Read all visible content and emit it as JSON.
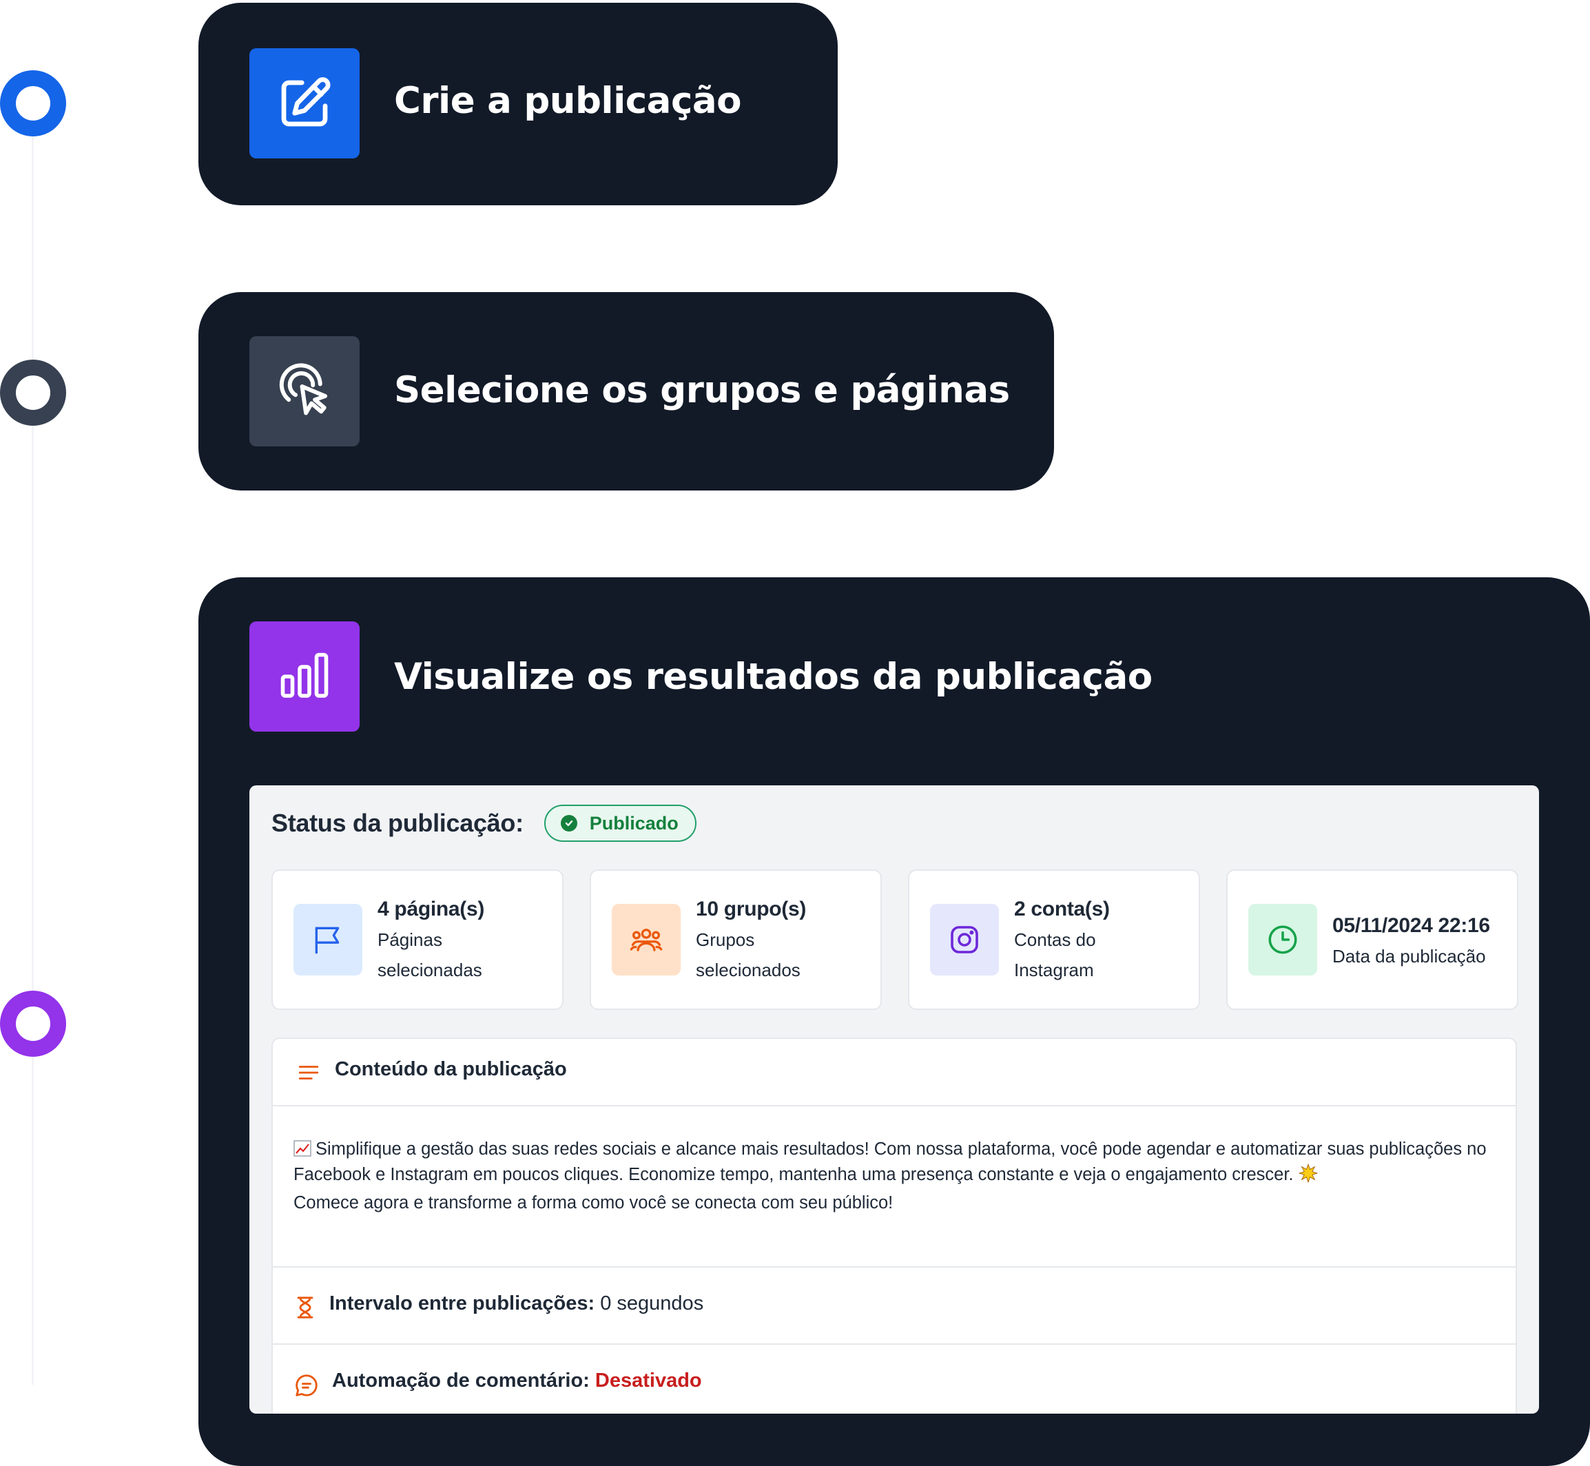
{
  "steps": [
    {
      "title": "Crie a publicação",
      "icon": "edit-icon",
      "color": "#1565e8"
    },
    {
      "title": "Selecione os grupos e páginas",
      "icon": "pointer-click-icon",
      "color": "#374151"
    },
    {
      "title": "Visualize os resultados da publicação",
      "icon": "bar-chart-icon",
      "color": "#9333ea"
    }
  ],
  "panel": {
    "status_label": "Status da publicação:",
    "status_badge": "Publicado",
    "stats": [
      {
        "value": "4 página(s)",
        "label": "Páginas selecionadas",
        "icon": "flag-icon",
        "accent": "#2563eb"
      },
      {
        "value": "10 grupo(s)",
        "label": "Grupos selecionados",
        "icon": "users-icon",
        "accent": "#ea580c"
      },
      {
        "value": "2 conta(s)",
        "label": "Contas do Instagram",
        "icon": "instagram-icon",
        "accent": "#6d28d9"
      },
      {
        "value": "05/11/2024 22:16",
        "label": "Data da publicação",
        "icon": "clock-icon",
        "accent": "#16a34a"
      }
    ],
    "content": {
      "title": "Conteúdo da publicação",
      "body": "Simplifique a gestão das suas redes sociais e alcance mais resultados! Com nossa plataforma, você pode agendar e automatizar suas publicações no Facebook e Instagram em poucos cliques. Economize tempo, mantenha uma presença constante e veja o engajamento crescer.",
      "body_end": "Comece agora e transforme a forma como você se conecta com seu público!"
    },
    "interval": {
      "label": "Intervalo entre publicações:",
      "value": "0 segundos"
    },
    "automation": {
      "label": "Automação de comentário:",
      "value": "Desativado"
    }
  }
}
